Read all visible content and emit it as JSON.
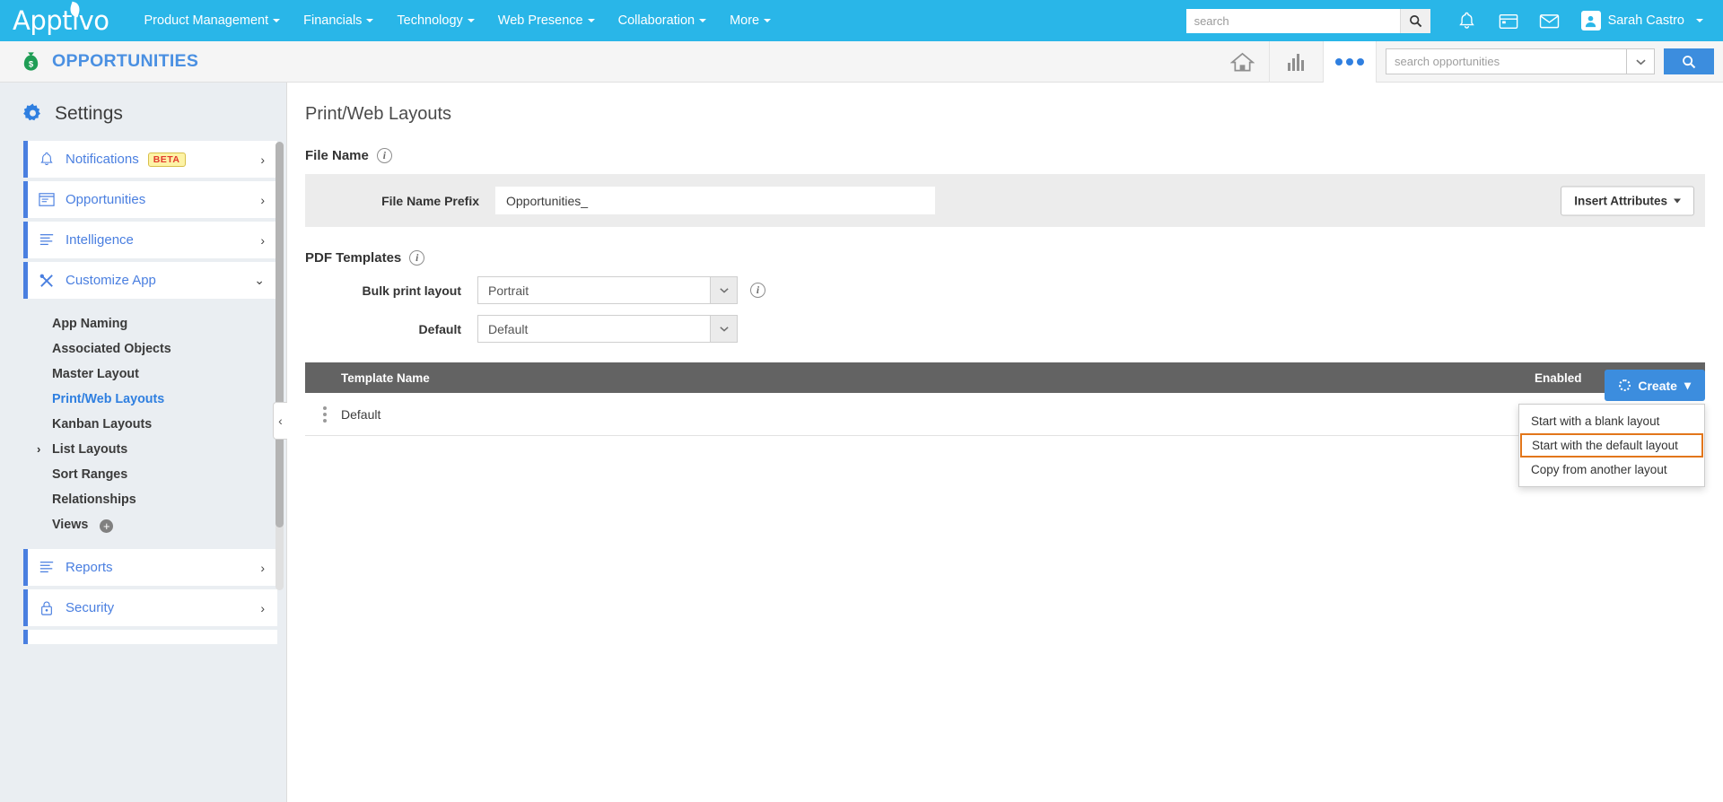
{
  "topnav": {
    "brand": "Apptivo",
    "links": [
      {
        "label": "Product Management"
      },
      {
        "label": "Financials"
      },
      {
        "label": "Technology"
      },
      {
        "label": "Web Presence"
      },
      {
        "label": "Collaboration"
      },
      {
        "label": "More"
      }
    ],
    "search_placeholder": "search",
    "search_value": "",
    "user_name": "Sarah Castro",
    "icons": [
      "search-icon",
      "bell-icon",
      "calendar-icon",
      "mail-icon",
      "avatar-icon"
    ],
    "accent_color": "#29b6e8"
  },
  "appbar": {
    "app_title": "OPPORTUNITIES",
    "app_icon": "money-bag-icon",
    "search_placeholder": "search opportunities",
    "search_value": "",
    "icons": [
      "home-icon",
      "bar-chart-icon",
      "more-dots-icon",
      "chevron-down-icon",
      "search-icon"
    ],
    "title_color": "#4a90e2"
  },
  "sidebar": {
    "heading": "Settings",
    "heading_icon": "gear-icon",
    "groups": [
      {
        "label": "Notifications",
        "icon": "bell-icon",
        "badge": "BETA",
        "chevron": "›"
      },
      {
        "label": "Opportunities",
        "icon": "window-icon",
        "chevron": "›"
      },
      {
        "label": "Intelligence",
        "icon": "list-lines-icon",
        "chevron": "›"
      },
      {
        "label": "Customize App",
        "icon": "tools-icon",
        "chevron": "⌄"
      }
    ],
    "sub_items": [
      {
        "label": "App Naming",
        "active": false,
        "arrow": "",
        "plus": false
      },
      {
        "label": "Associated Objects",
        "active": false,
        "arrow": "",
        "plus": false
      },
      {
        "label": "Master Layout",
        "active": false,
        "arrow": "",
        "plus": false
      },
      {
        "label": "Print/Web Layouts",
        "active": true,
        "arrow": "",
        "plus": false
      },
      {
        "label": "Kanban Layouts",
        "active": false,
        "arrow": "",
        "plus": false
      },
      {
        "label": "List Layouts",
        "active": false,
        "arrow": "›",
        "plus": false
      },
      {
        "label": "Sort Ranges",
        "active": false,
        "arrow": "",
        "plus": false
      },
      {
        "label": "Relationships",
        "active": false,
        "arrow": "",
        "plus": false
      },
      {
        "label": "Views",
        "active": false,
        "arrow": "",
        "plus": true
      }
    ],
    "lower_groups": [
      {
        "label": "Reports",
        "icon": "list-lines-icon",
        "chevron": "›"
      },
      {
        "label": "Security",
        "icon": "lock-icon",
        "chevron": "›"
      }
    ],
    "collapse_handle": "‹"
  },
  "main": {
    "page_title": "Print/Web Layouts",
    "file_name": {
      "section_label": "File Name",
      "info_icon": "info-icon",
      "field_label": "File Name Prefix",
      "field_value": "Opportunities_",
      "field_placeholder": "",
      "insert_attributes_label": "Insert Attributes"
    },
    "pdf_templates": {
      "section_label": "PDF Templates",
      "info_icon": "info-icon",
      "rows": [
        {
          "label": "Bulk print layout",
          "value": "Portrait",
          "has_info": true
        },
        {
          "label": "Default",
          "value": "Default",
          "has_info": false
        }
      ]
    },
    "table": {
      "columns": [
        "Template Name",
        "Enabled"
      ],
      "rows": [
        {
          "name": "Default",
          "enabled": true
        }
      ]
    },
    "create": {
      "label": "Create",
      "icon": "gear-icon",
      "caret": "▾",
      "menu_items": [
        {
          "label": "Start with a blank layout",
          "highlighted": false
        },
        {
          "label": "Start with the default layout",
          "highlighted": true
        },
        {
          "label": "Copy from another layout",
          "highlighted": false
        }
      ],
      "button_color": "#3c8dde",
      "highlight_color": "#e2761b"
    }
  }
}
